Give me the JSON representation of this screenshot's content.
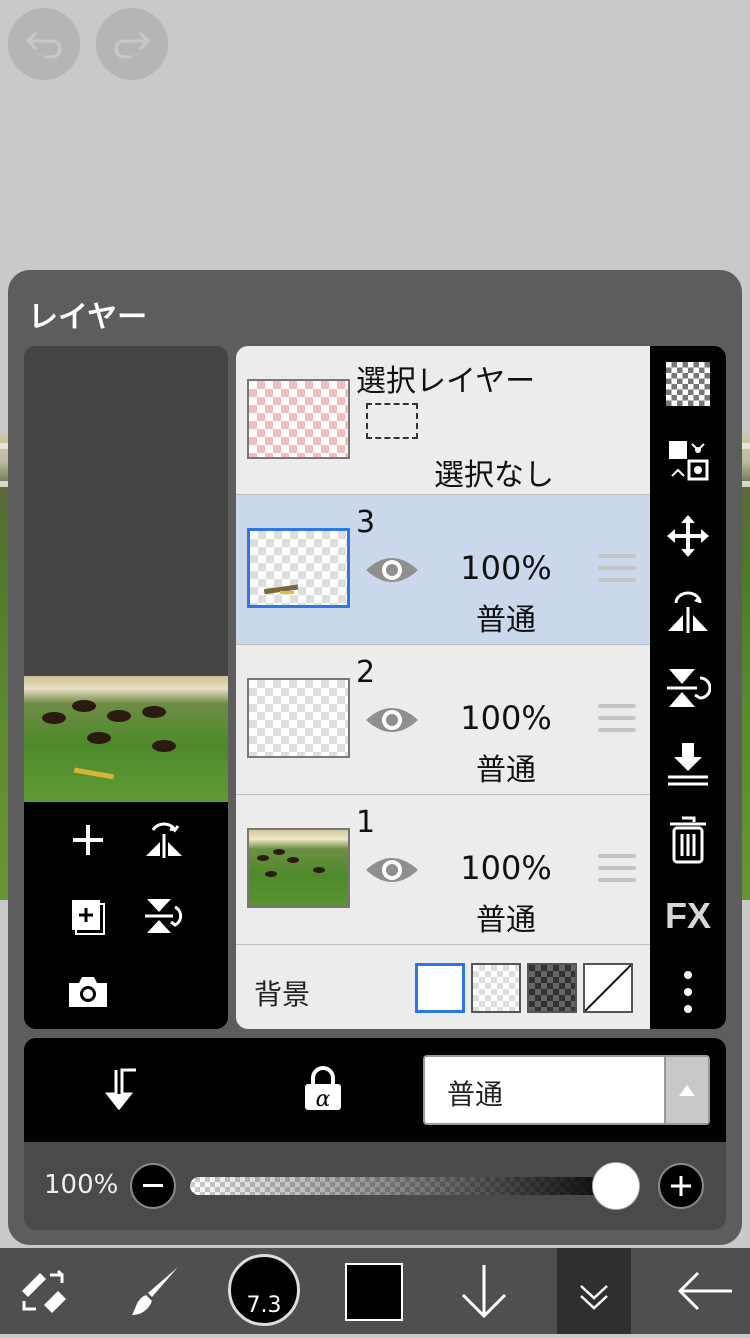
{
  "panel": {
    "title": "レイヤー"
  },
  "selection_layer": {
    "title": "選択レイヤー",
    "status": "選択なし"
  },
  "layers": [
    {
      "number": "3",
      "opacity": "100%",
      "blend_mode": "普通",
      "selected": true
    },
    {
      "number": "2",
      "opacity": "100%",
      "blend_mode": "普通",
      "selected": false
    },
    {
      "number": "1",
      "opacity": "100%",
      "blend_mode": "普通",
      "selected": false
    }
  ],
  "background": {
    "label": "背景",
    "options": [
      "white",
      "transparent",
      "dark-transparent",
      "none"
    ],
    "selected": "white"
  },
  "blend_mode_select": {
    "value": "普通"
  },
  "opacity_slider": {
    "label": "100%",
    "value": 1.0
  },
  "toolbar": {
    "brush_size": "7.3",
    "current_color": "#000000"
  },
  "colors": {
    "accent": "#2b78e4",
    "selected_row": "#cbd8ec",
    "panel": "#5d5d5d"
  },
  "icons": {
    "top": [
      "undo-icon",
      "redo-icon"
    ],
    "left_col": [
      "add-layer-icon",
      "flip-horizontal-icon",
      "add-page-icon",
      "flip-vertical-icon",
      "camera-icon"
    ],
    "right_col": [
      "transparency-icon",
      "swap-icon",
      "move-icon",
      "flip-horizontal-icon",
      "flip-vertical-icon",
      "merge-down-icon",
      "trash-icon",
      "fx-icon",
      "more-icon"
    ],
    "bottom": [
      "tool-switch-icon",
      "brush-icon",
      "brush-size",
      "color-swatch",
      "down-arrow-icon",
      "collapse-icon",
      "back-arrow-icon"
    ]
  },
  "fx_label": "FX"
}
